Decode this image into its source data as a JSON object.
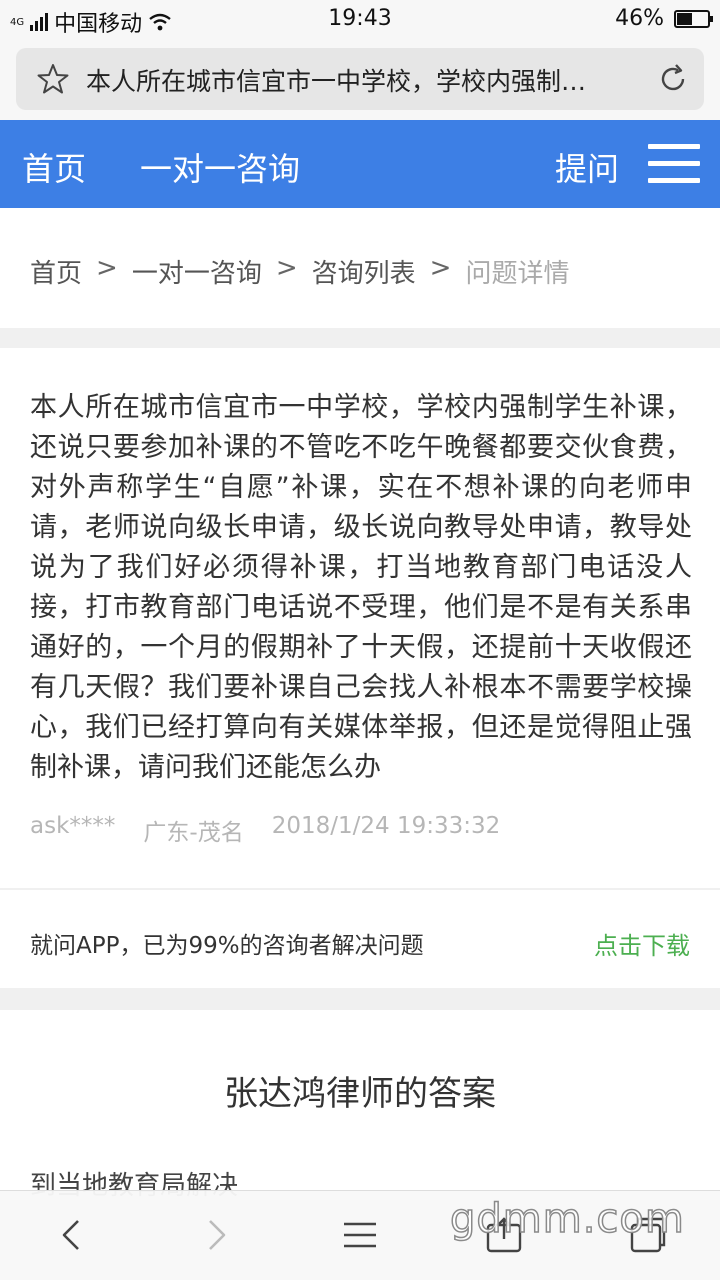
{
  "status_bar": {
    "network": "4G",
    "carrier": "中国移动",
    "time": "19:43",
    "battery": "46%",
    "battery_level": 0.46
  },
  "url_bar": {
    "title": "本人所在城市信宜市一中学校，学校内强制…"
  },
  "header": {
    "home": "首页",
    "consult": "一对一咨询",
    "ask": "提问"
  },
  "breadcrumb": {
    "items": [
      "首页",
      "一对一咨询",
      "咨询列表"
    ],
    "current": "问题详情",
    "separator": ">"
  },
  "question": {
    "text": "本人所在城市信宜市一中学校，学校内强制学生补课，还说只要参加补课的不管吃不吃午晚餐都要交伙食费，对外声称学生“自愿”补课，实在不想补课的向老师申请，老师说向级长申请，级长说向教导处申请，教导处说为了我们好必须得补课，打当地教育部门电话没人接，打市教育部门电话说不受理，他们是不是有关系串通好的，一个月的假期补了十天假，还提前十天收假还有几天假？我们要补课自己会找人补根本不需要学校操心，我们已经打算向有关媒体举报，但还是觉得阻止强制补课，请问我们还能怎么办",
    "user": "ask****",
    "location": "广东-茂名",
    "time": "2018/1/24 19:33:32"
  },
  "app_banner": {
    "text": "就问APP，已为99%的咨询者解决问题",
    "download": "点击下载"
  },
  "answer": {
    "title": "张达鸿律师的答案",
    "text": "到当地教育局解决"
  },
  "watermark": "gdmm.com"
}
